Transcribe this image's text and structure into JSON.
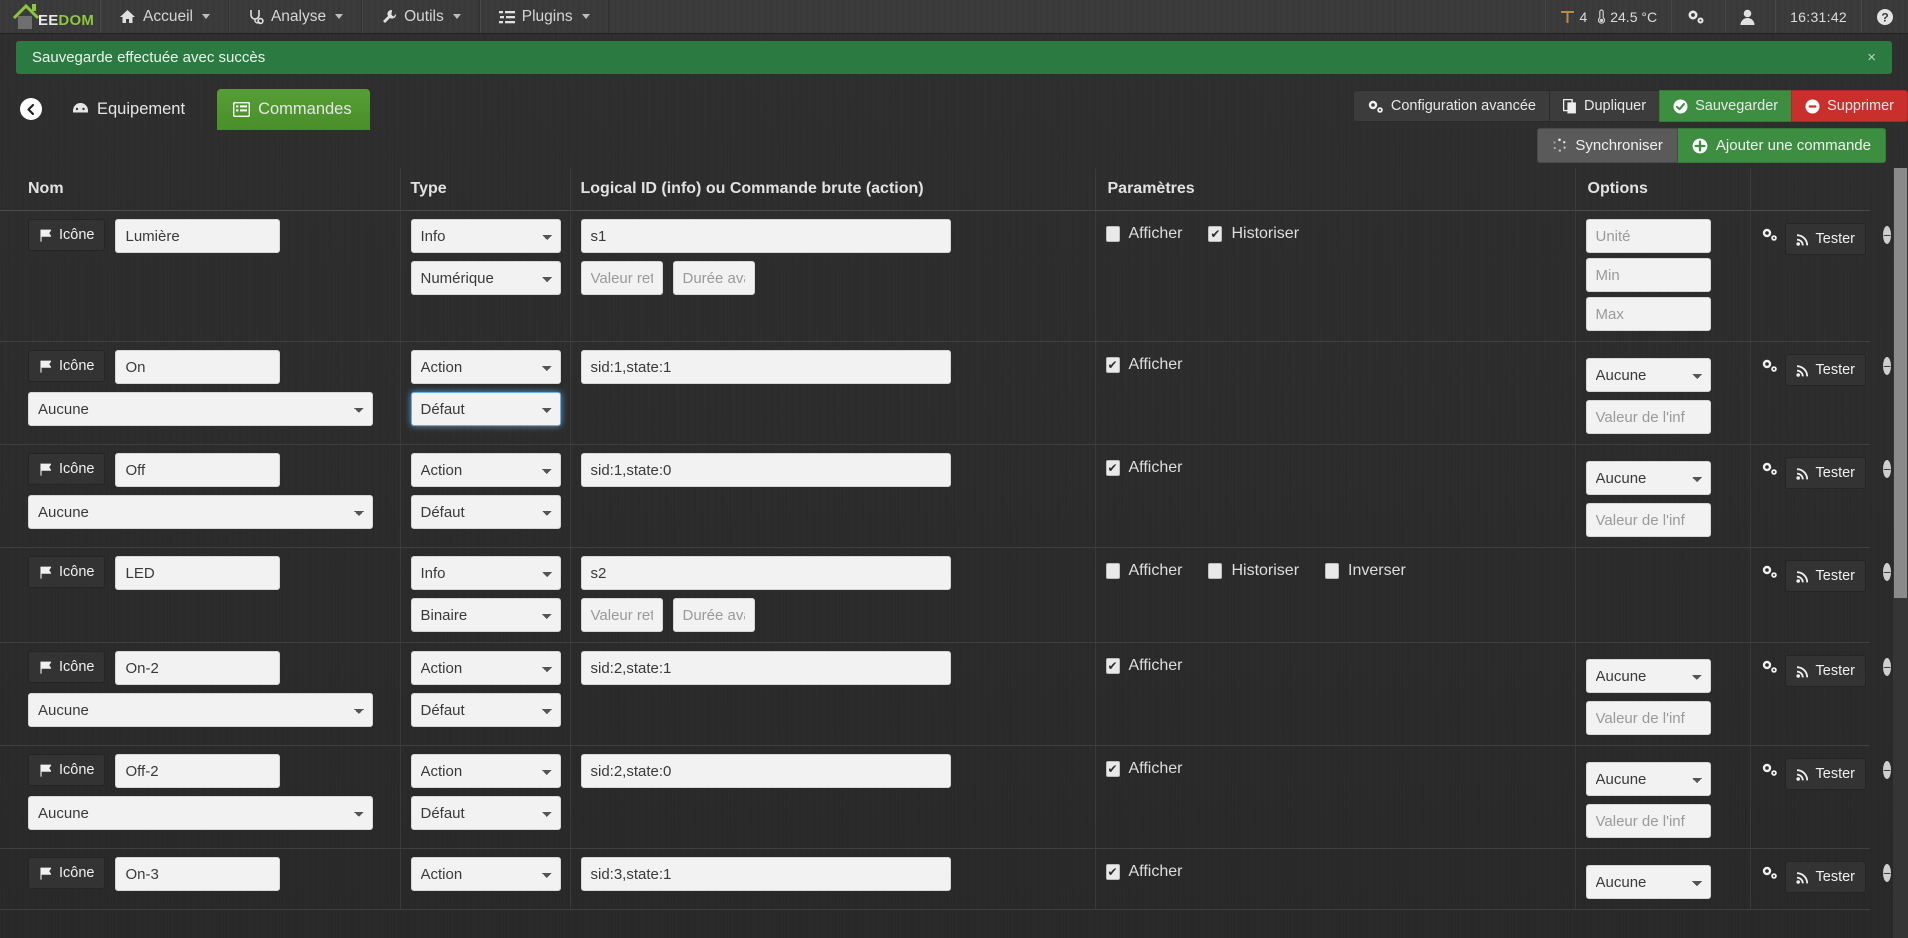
{
  "navbar": {
    "brand": {
      "white": "EE",
      "green": "DOM"
    },
    "menus": [
      {
        "label": "Accueil",
        "icon": "home-icon"
      },
      {
        "label": "Analyse",
        "icon": "stethoscope-icon"
      },
      {
        "label": "Outils",
        "icon": "wrench-icon"
      },
      {
        "label": "Plugins",
        "icon": "list-icon"
      }
    ],
    "summary": {
      "window_count": "4",
      "temperature": "24.5 °C"
    },
    "clock": "16:31:42",
    "gear_label": "gear-dropdown",
    "user_label": "user-dropdown",
    "help_label": "help-icon"
  },
  "alert": {
    "message": "Sauvegarde effectuée avec succès",
    "close": "×"
  },
  "tabs": [
    {
      "label": "Equipement",
      "icon": "dashboard-icon",
      "active": false
    },
    {
      "label": "Commandes",
      "icon": "list-alt-icon",
      "active": true
    }
  ],
  "top_actions": [
    {
      "label": "Configuration avancée",
      "icon": "cogs-icon",
      "style": "default"
    },
    {
      "label": "Dupliquer",
      "icon": "copy-icon",
      "style": "default"
    },
    {
      "label": "Sauvegarder",
      "icon": "check-circle-icon",
      "style": "green"
    },
    {
      "label": "Supprimer",
      "icon": "minus-circle-icon",
      "style": "red"
    }
  ],
  "sub_actions": [
    {
      "label": "Synchroniser",
      "icon": "spinner-icon",
      "style": "default"
    },
    {
      "label": "Ajouter une commande",
      "icon": "plus-circle-icon",
      "style": "green"
    }
  ],
  "table": {
    "headers": {
      "nom": "Nom",
      "type": "Type",
      "logical_id": "Logical ID (info) ou Commande brute (action)",
      "parametres": "Paramètres",
      "options": "Options"
    },
    "common": {
      "icon_button": "Icône",
      "test_button": "Tester",
      "gear": "cogs-icon",
      "remove": "remove-icon",
      "placeholder_valeur_retour": "Valeur reto",
      "placeholder_duree_avant": "Durée avar",
      "placeholder_valeur_info": "Valeur de l'inf",
      "placeholder_unite": "Unité",
      "placeholder_min": "Min",
      "placeholder_max": "Max",
      "label_afficher": "Afficher",
      "label_historiser": "Historiser",
      "label_inverser": "Inverser",
      "check_mark": "✔"
    },
    "rows": [
      {
        "name": "Lumière",
        "type": "Info",
        "subtype": "Numérique",
        "subtype_focused": false,
        "logical_id": "s1",
        "has_info_extras": true,
        "cascade": null,
        "checks": [
          {
            "label": "Afficher",
            "checked": false
          },
          {
            "label": "Historiser",
            "checked": true
          }
        ],
        "options_kind": "info",
        "option_unit": "Unité",
        "option_min": "Min",
        "option_max": "Max"
      },
      {
        "name": "On",
        "type": "Action",
        "subtype": "Défaut",
        "subtype_focused": true,
        "logical_id": "sid:1,state:1",
        "has_info_extras": false,
        "cascade": "Aucune",
        "checks": [
          {
            "label": "Afficher",
            "checked": true
          }
        ],
        "options_kind": "action",
        "option_select": "Aucune",
        "option_value_placeholder": "Valeur de l'inf"
      },
      {
        "name": "Off",
        "type": "Action",
        "subtype": "Défaut",
        "subtype_focused": false,
        "logical_id": "sid:1,state:0",
        "has_info_extras": false,
        "cascade": "Aucune",
        "checks": [
          {
            "label": "Afficher",
            "checked": true
          }
        ],
        "options_kind": "action",
        "option_select": "Aucune",
        "option_value_placeholder": "Valeur de l'inf"
      },
      {
        "name": "LED",
        "type": "Info",
        "subtype": "Binaire",
        "subtype_focused": false,
        "logical_id": "s2",
        "has_info_extras": true,
        "cascade": null,
        "checks": [
          {
            "label": "Afficher",
            "checked": false
          },
          {
            "label": "Historiser",
            "checked": false
          },
          {
            "label": "Inverser",
            "checked": false
          }
        ],
        "options_kind": "none"
      },
      {
        "name": "On-2",
        "type": "Action",
        "subtype": "Défaut",
        "subtype_focused": false,
        "logical_id": "sid:2,state:1",
        "has_info_extras": false,
        "cascade": "Aucune",
        "checks": [
          {
            "label": "Afficher",
            "checked": true
          }
        ],
        "options_kind": "action",
        "option_select": "Aucune",
        "option_value_placeholder": "Valeur de l'inf"
      },
      {
        "name": "Off-2",
        "type": "Action",
        "subtype": "Défaut",
        "subtype_focused": false,
        "logical_id": "sid:2,state:0",
        "has_info_extras": false,
        "cascade": "Aucune",
        "checks": [
          {
            "label": "Afficher",
            "checked": true
          }
        ],
        "options_kind": "action",
        "option_select": "Aucune",
        "option_value_placeholder": "Valeur de l'inf"
      },
      {
        "name": "On-3",
        "type": "Action",
        "subtype": null,
        "subtype_focused": false,
        "logical_id": "sid:3,state:1",
        "has_info_extras": false,
        "cascade": null,
        "checks": [
          {
            "label": "Afficher",
            "checked": true
          }
        ],
        "options_kind": "action",
        "option_select": "Aucune",
        "option_value_placeholder": null
      }
    ]
  },
  "colors": {
    "accent_green": "#4e9a2f",
    "alert_green": "#2b7a41",
    "danger_red": "#c9302c",
    "navbar_bg": "#3a3a3a",
    "page_bg": "#2b2b2b"
  }
}
